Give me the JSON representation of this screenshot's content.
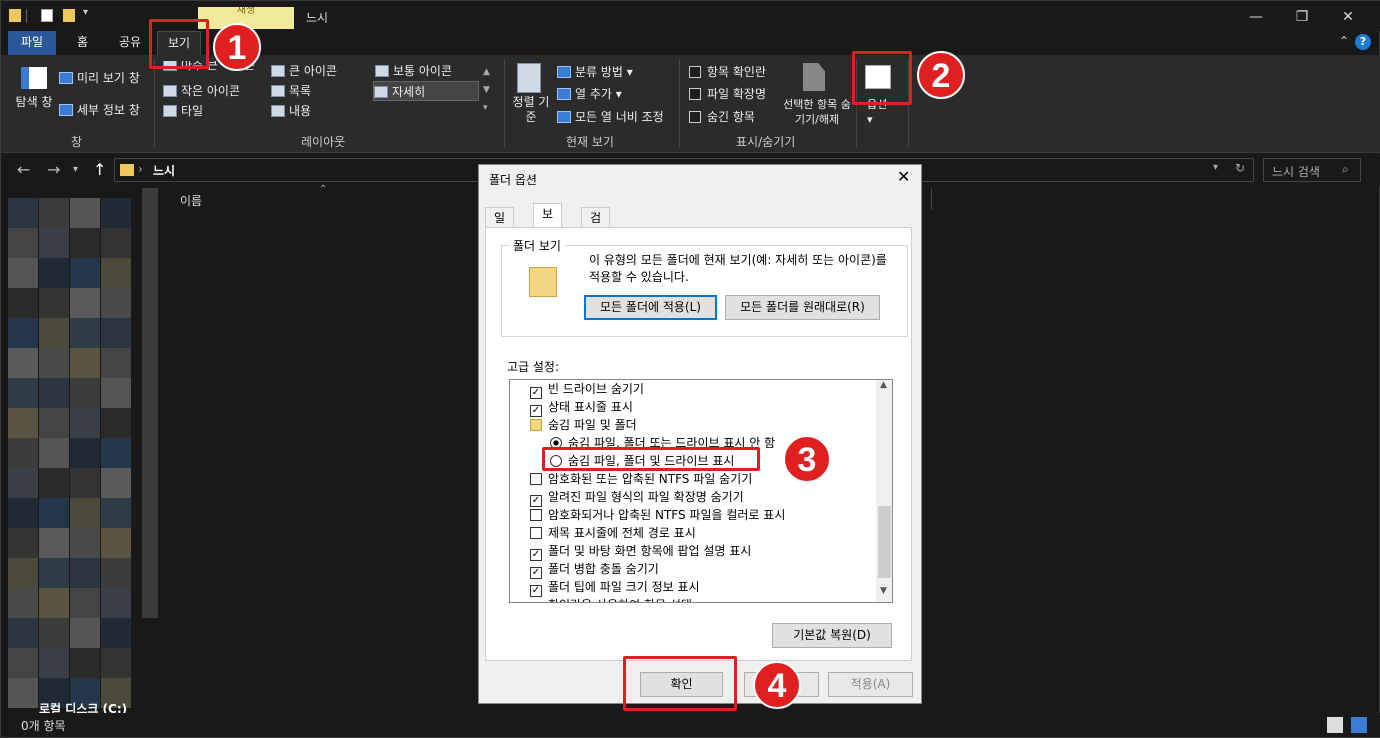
{
  "window": {
    "title": "느시",
    "context_tab": "재생"
  },
  "tabs": [
    {
      "label": "파일"
    },
    {
      "label": "홈"
    },
    {
      "label": "공유"
    },
    {
      "label": "보기"
    }
  ],
  "ribbon": {
    "pane": {
      "nav_pane": "탐색 창",
      "preview": "미리 보기 창",
      "details": "세부 정보 창",
      "group": "창"
    },
    "layout": {
      "items": [
        "아주 큰 아이콘",
        "큰 아이콘",
        "보통 아이콘",
        "작은 아이콘",
        "목록",
        "자세히",
        "타일",
        "내용"
      ],
      "group": "레이아웃"
    },
    "current_view": {
      "sort": "정렬 기준",
      "group_by": "분류 방법",
      "add_column": "열 추가",
      "fit_columns": "모든 열 너비 조정",
      "group": "현재 보기"
    },
    "show_hide": {
      "item_checkbox": "항목 확인란",
      "file_ext": "파일 확장명",
      "hidden_items": "숨긴 항목",
      "hide_selected": "선택한 항목 숨기기/해제",
      "group": "표시/숨기기"
    },
    "options": "옵션"
  },
  "address": {
    "path": "느시",
    "search_placeholder": "느시 검색"
  },
  "content": {
    "column_name": "이름"
  },
  "nav_pane": {
    "drive": "로컬 디스크 (C:)"
  },
  "status": {
    "count": "0개 항목"
  },
  "dialog": {
    "title": "폴더 옵션",
    "tabs": [
      "일반",
      "보기",
      "검색"
    ],
    "folder_view": {
      "label": "폴더 보기",
      "description": "이 유형의 모든 폴더에 현재 보기(예: 자세히 또는 아이콘)를 적용할 수 있습니다.",
      "apply_all": "모든 폴더에 적용(L)",
      "reset_all": "모든 폴더를 원래대로(R)"
    },
    "advanced": {
      "label": "고급 설정:",
      "items": [
        {
          "text": "빈 드라이브 숨기기",
          "kind": "check",
          "checked": true
        },
        {
          "text": "상태 표시줄 표시",
          "kind": "check",
          "checked": true
        },
        {
          "text": "숨김 파일 및 폴더",
          "kind": "folder",
          "checked": false
        },
        {
          "text": "숨김 파일, 폴더 또는 드라이브 표시 안 함",
          "kind": "radio",
          "checked": true
        },
        {
          "text": "숨김 파일, 폴더 및 드라이브 표시",
          "kind": "radio",
          "checked": false
        },
        {
          "text": "암호화된 또는 압축된 NTFS 파일 숨기기",
          "kind": "check",
          "checked": false
        },
        {
          "text": "알려진 파일 형식의 파일 확장명 숨기기",
          "kind": "check",
          "checked": true
        },
        {
          "text": "암호화되거나 압축된 NTFS 파일을 컬러로 표시",
          "kind": "check",
          "checked": false
        },
        {
          "text": "제목 표시줄에 전체 경로 표시",
          "kind": "check",
          "checked": false
        },
        {
          "text": "폴더 및 바탕 화면 항목에 팝업 설명 표시",
          "kind": "check",
          "checked": true
        },
        {
          "text": "폴더 병합 충돌 숨기기",
          "kind": "check",
          "checked": true
        },
        {
          "text": "폴더 팁에 파일 크기 정보 표시",
          "kind": "check",
          "checked": true
        },
        {
          "text": "확인란을 사용하여 항목 선택",
          "kind": "check",
          "checked": true
        }
      ]
    },
    "restore": "기본값 복원(D)",
    "ok": "확인",
    "cancel": "취소",
    "apply": "적용(A)"
  },
  "annotations": [
    "1",
    "2",
    "3",
    "4"
  ],
  "colors": {
    "highlight": "#e02020",
    "file_tab": "#2b5797",
    "accent": "#0078d7"
  }
}
